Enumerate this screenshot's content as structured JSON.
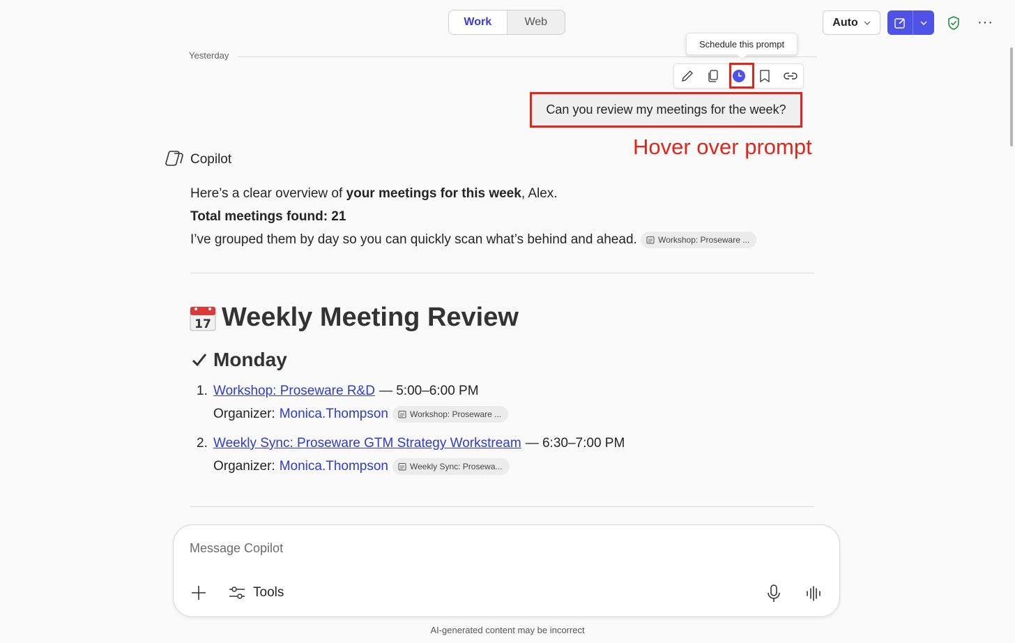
{
  "mode_toggle": {
    "work": "Work",
    "web": "Web"
  },
  "header": {
    "model_label": "Auto"
  },
  "thread": {
    "date_label": "Yesterday",
    "tooltip": "Schedule this prompt",
    "user_prompt": "Can you review my meetings for the week?",
    "annotation": "Hover over prompt",
    "assistant_name": "Copilot",
    "intro_pre": "Here’s a clear overview of ",
    "intro_bold": "your meetings for this week",
    "intro_post": ", Alex.",
    "total": "Total meetings found: 21",
    "grouped": "I’ve grouped them by day so you can quickly scan what’s behind and ahead.",
    "grouped_chip": "Workshop: Proseware ...",
    "heading": "Weekly Meeting Review",
    "day": "Monday",
    "meetings": [
      {
        "num": "1.",
        "title": "Workshop: Proseware R&D",
        "time": "— 5:00–6:00 PM",
        "organizer_label": "Organizer:",
        "organizer": "Monica.Thompson",
        "chip": "Workshop: Proseware ..."
      },
      {
        "num": "2.",
        "title": "Weekly Sync: Proseware GTM Strategy Workstream",
        "time": "— 6:30–7:00 PM",
        "organizer_label": "Organizer:",
        "organizer": "Monica.Thompson",
        "chip": "Weekly Sync: Prosewa..."
      }
    ]
  },
  "composer": {
    "placeholder": "Message Copilot",
    "tools_label": "Tools"
  },
  "footer": {
    "disclaimer": "AI-generated content may be incorrect"
  },
  "colors": {
    "accent": "#4f52e6",
    "highlight": "#e0261b",
    "link": "#2e3bd1"
  },
  "icons": [
    "edit-icon",
    "copy-icon",
    "clock-icon",
    "bookmark-icon",
    "link-icon",
    "calendar-emoji-icon",
    "check-icon",
    "plus-icon",
    "tools-icon",
    "mic-icon",
    "voice-icon",
    "shield-icon",
    "more-icon",
    "chevron-down-icon",
    "compose-icon"
  ]
}
